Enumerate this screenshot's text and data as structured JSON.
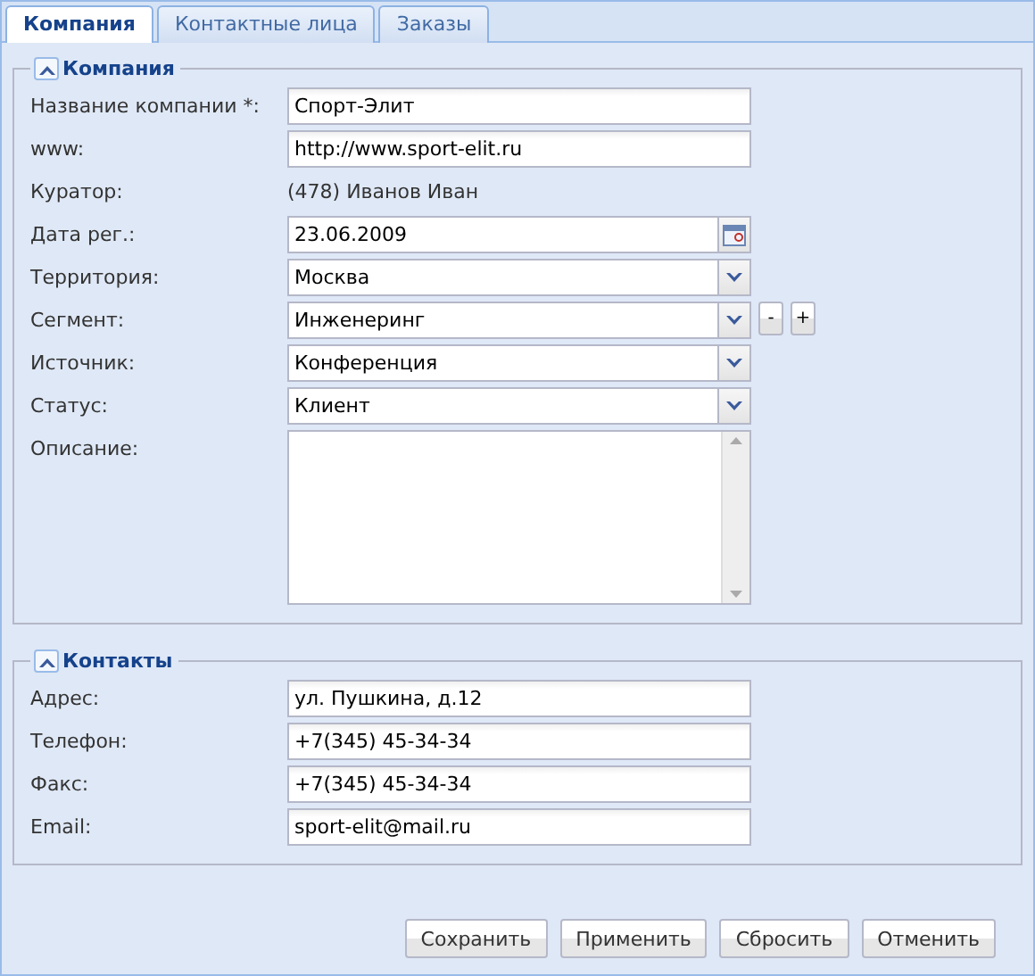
{
  "tabs": [
    {
      "label": "Компания",
      "selected": true
    },
    {
      "label": "Контактные лица",
      "selected": false
    },
    {
      "label": "Заказы",
      "selected": false
    }
  ],
  "sections": [
    {
      "title": "Компания",
      "expanded": true,
      "fields": [
        {
          "kind": "text",
          "label": "Название компании *:",
          "value": "Спорт-Элит"
        },
        {
          "kind": "text",
          "label": "www:",
          "value": "http://www.sport-elit.ru"
        },
        {
          "kind": "static",
          "label": "Куратор:",
          "value": "(478) Иванов Иван"
        },
        {
          "kind": "date",
          "label": "Дата рег.:",
          "value": "23.06.2009"
        },
        {
          "kind": "combo",
          "label": "Территория:",
          "value": "Москва"
        },
        {
          "kind": "combo",
          "label": "Сегмент:",
          "value": "Инженеринг",
          "buttons": [
            "-",
            "+"
          ]
        },
        {
          "kind": "combo",
          "label": "Источник:",
          "value": "Конференция"
        },
        {
          "kind": "combo",
          "label": "Статус:",
          "value": "Клиент"
        },
        {
          "kind": "textarea",
          "label": "Описание:"
        }
      ]
    },
    {
      "title": "Контакты",
      "expanded": true,
      "fields": [
        {
          "kind": "text",
          "label": "Адрес:",
          "value": "ул. Пушкина, д.12"
        },
        {
          "kind": "text",
          "label": "Телефон:",
          "value": "+7(345) 45-34-34"
        },
        {
          "kind": "text",
          "label": "Факс:",
          "value": "+7(345) 45-34-34"
        },
        {
          "kind": "text",
          "label": "Email:",
          "value": "sport-elit@mail.ru"
        }
      ]
    }
  ],
  "buttons": [
    "Сохранить",
    "Применить",
    "Сбросить",
    "Отменить"
  ]
}
